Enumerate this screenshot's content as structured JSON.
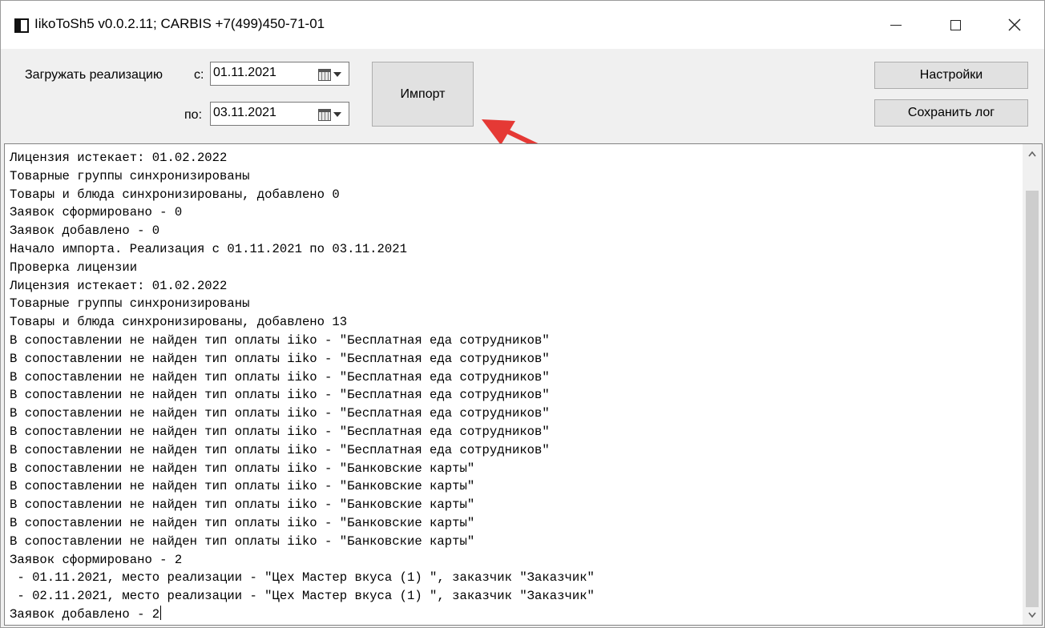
{
  "window": {
    "title": "IikoToSh5 v0.0.2.11;  CARBIS +7(499)450-71-01",
    "icons": {
      "app": "app-icon",
      "minimize": "minimize-icon",
      "maximize": "maximize-icon",
      "close": "close-icon"
    }
  },
  "toolbar": {
    "load_label": "Загружать реализацию",
    "from_label": "с:",
    "to_label": "по:",
    "from_date": "01.11.2021",
    "to_date": "03.11.2021",
    "import_button": "Импорт",
    "settings_button": "Настройки",
    "save_log_button": "Сохранить лог",
    "date_picker_icon": "calendar-icon"
  },
  "annotation": {
    "arrow_color": "#e53935",
    "icon": "red-arrow-icon"
  },
  "log": {
    "lines": [
      "Лицензия истекает: 01.02.2022",
      "Товарные группы синхронизированы",
      "Товары и блюда синхронизированы, добавлено 0",
      "Заявок сформировано - 0",
      "Заявок добавлено - 0",
      "Начало импорта. Реализация с 01.11.2021 по 03.11.2021",
      "Проверка лицензии",
      "Лицензия истекает: 01.02.2022",
      "Товарные группы синхронизированы",
      "Товары и блюда синхронизированы, добавлено 13",
      "В сопоставлении не найден тип оплаты iiko - \"Бесплатная еда сотрудников\"",
      "В сопоставлении не найден тип оплаты iiko - \"Бесплатная еда сотрудников\"",
      "В сопоставлении не найден тип оплаты iiko - \"Бесплатная еда сотрудников\"",
      "В сопоставлении не найден тип оплаты iiko - \"Бесплатная еда сотрудников\"",
      "В сопоставлении не найден тип оплаты iiko - \"Бесплатная еда сотрудников\"",
      "В сопоставлении не найден тип оплаты iiko - \"Бесплатная еда сотрудников\"",
      "В сопоставлении не найден тип оплаты iiko - \"Бесплатная еда сотрудников\"",
      "В сопоставлении не найден тип оплаты iiko - \"Банковские карты\"",
      "В сопоставлении не найден тип оплаты iiko - \"Банковские карты\"",
      "В сопоставлении не найден тип оплаты iiko - \"Банковские карты\"",
      "В сопоставлении не найден тип оплаты iiko - \"Банковские карты\"",
      "В сопоставлении не найден тип оплаты iiko - \"Банковские карты\"",
      "Заявок сформировано - 2",
      " - 01.11.2021, место реализации - \"Цех Мастер вкуса (1) \", заказчик \"Заказчик\"",
      " - 02.11.2021, место реализации - \"Цех Мастер вкуса (1) \", заказчик \"Заказчик\"",
      "Заявок добавлено - 2"
    ]
  }
}
